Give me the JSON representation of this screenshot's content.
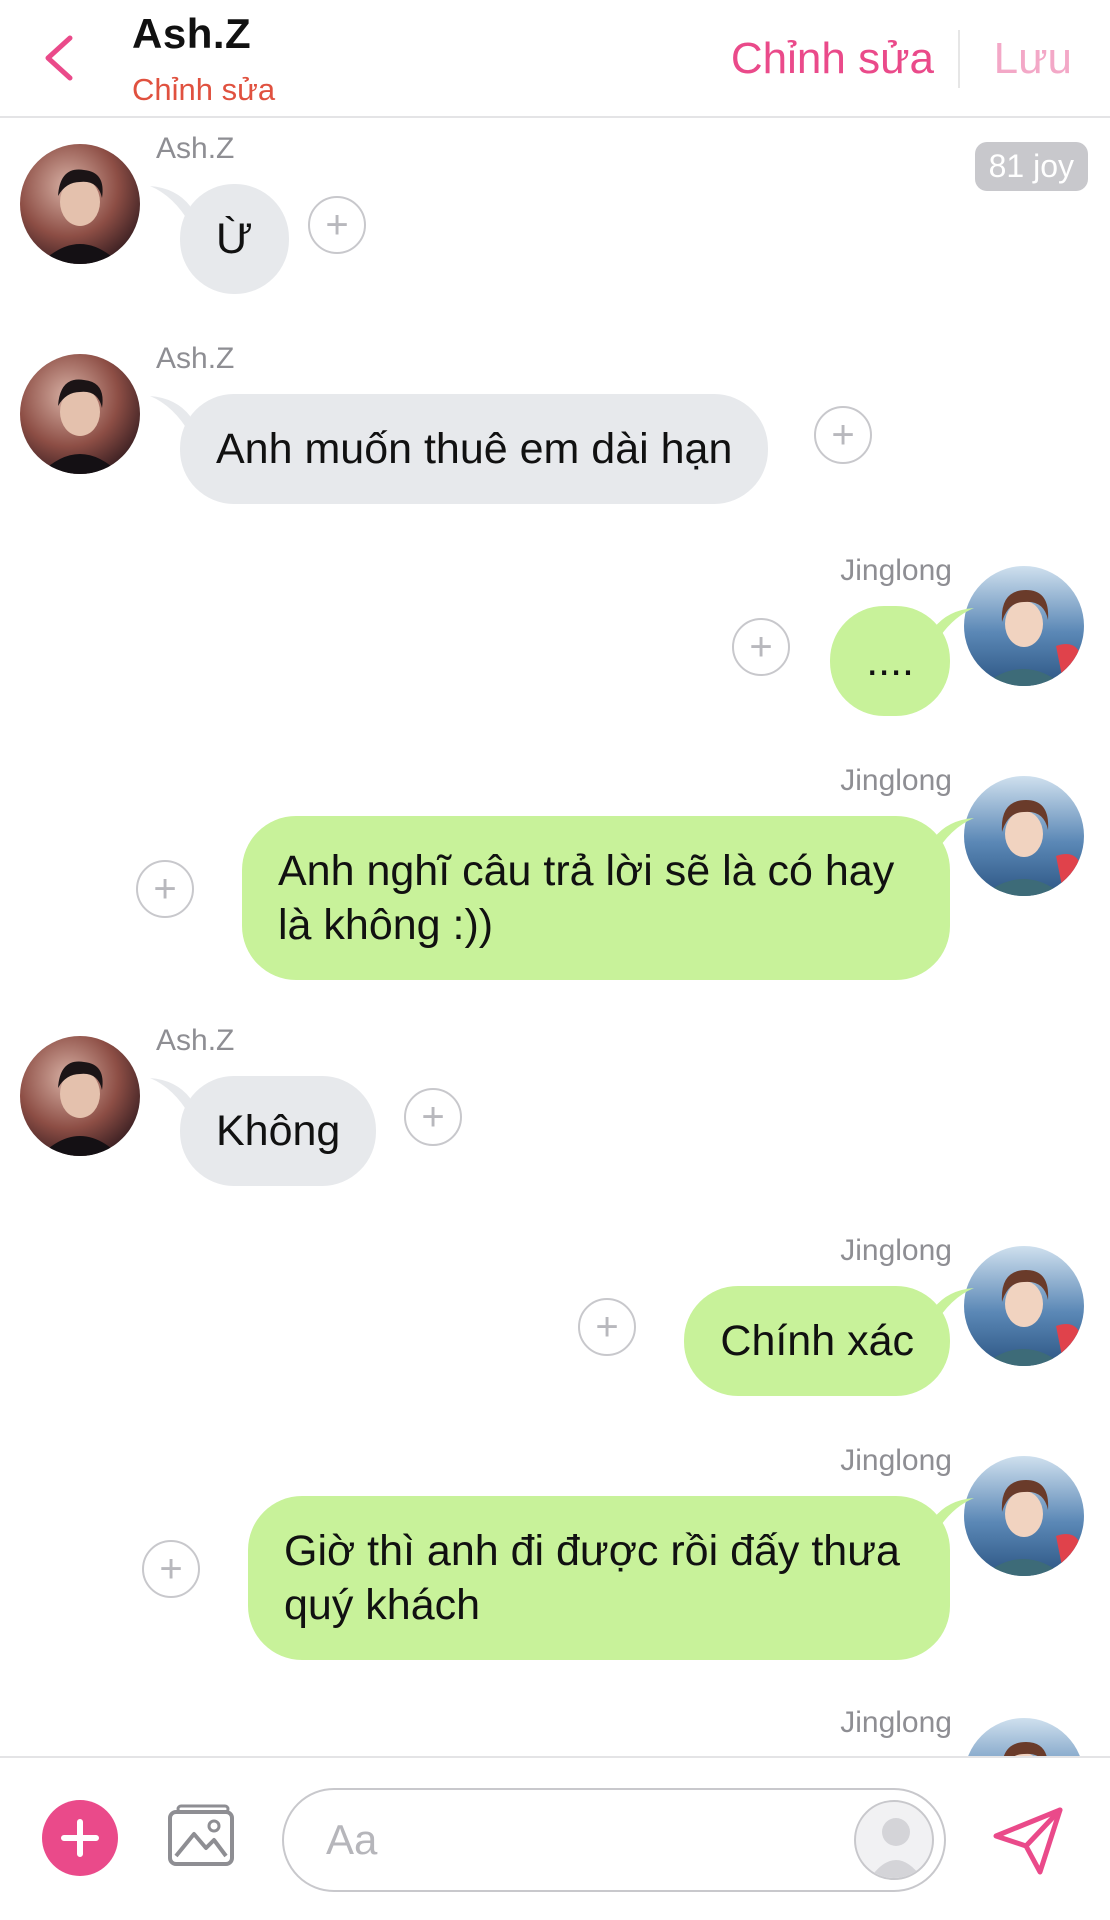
{
  "header": {
    "title": "Ash.Z",
    "subtitle": "Chỉnh sửa",
    "edit_label": "Chỉnh sửa",
    "save_label": "Lưu"
  },
  "badge": {
    "joy": "81 joy"
  },
  "messages": [
    {
      "side": "left",
      "sender": "Ash.Z",
      "text": "Ừ"
    },
    {
      "side": "left",
      "sender": "Ash.Z",
      "text": "Anh muốn thuê em dài hạn"
    },
    {
      "side": "right",
      "sender": "Jinglong",
      "text": "...."
    },
    {
      "side": "right",
      "sender": "Jinglong",
      "text": "Anh nghĩ câu trả lời sẽ là có hay là không :))"
    },
    {
      "side": "left",
      "sender": "Ash.Z",
      "text": "Không"
    },
    {
      "side": "right",
      "sender": "Jinglong",
      "text": "Chính xác"
    },
    {
      "side": "right",
      "sender": "Jinglong",
      "text": "Giờ thì anh đi được rồi đấy thưa quý khách"
    },
    {
      "side": "right",
      "sender": "Jinglong",
      "text": ""
    }
  ],
  "composer": {
    "placeholder": "Aa"
  },
  "colors": {
    "accent": "#ea4a8a",
    "subtitle": "#e0513f",
    "incoming_bubble": "#e7e9ec",
    "outgoing_bubble": "#c8f29a"
  }
}
